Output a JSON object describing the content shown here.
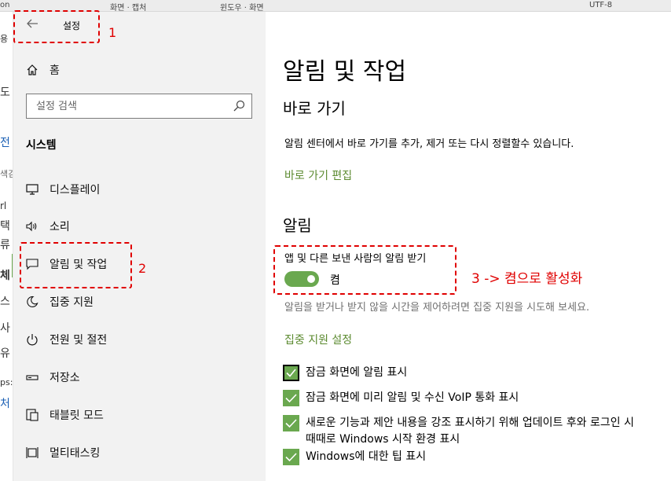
{
  "background_window": {
    "top_fragments": [
      "on",
      "화면 · 캡처",
      "윈도우 · 화면",
      "UTF-8"
    ],
    "left_fragments": [
      "용",
      "도",
      "전",
      "색검",
      "rl",
      "택",
      "류",
      "체",
      "스",
      "사",
      "유",
      "ps:",
      "처"
    ]
  },
  "window": {
    "title": "설정"
  },
  "sidebar": {
    "home_label": "홈",
    "search_placeholder": "설정 검색",
    "section_title": "시스템",
    "items": [
      {
        "label": "디스플레이",
        "icon": "monitor-icon"
      },
      {
        "label": "소리",
        "icon": "speaker-icon"
      },
      {
        "label": "알림 및 작업",
        "icon": "notification-icon"
      },
      {
        "label": "집중 지원",
        "icon": "moon-icon"
      },
      {
        "label": "전원 및 절전",
        "icon": "power-icon"
      },
      {
        "label": "저장소",
        "icon": "storage-icon"
      },
      {
        "label": "태블릿 모드",
        "icon": "tablet-icon"
      },
      {
        "label": "멀티태스킹",
        "icon": "multitask-icon"
      }
    ]
  },
  "main": {
    "page_title": "알림 및 작업",
    "shortcuts": {
      "heading": "바로 가기",
      "description": "알림 센터에서 바로 가기를 추가, 제거 또는 다시 정렬할수 있습니다.",
      "edit_link": "바로 가기 편집"
    },
    "notifications": {
      "heading": "알림",
      "toggle_label": "앱 및 다른 보낸 사람의 알림 받기",
      "toggle_state": "켬",
      "toggle_on": true,
      "hint": "알림을 받거나 받지 않을 시간을 제어하려면 집중 지원을 시도해 보세요.",
      "focus_link": "집중 지원 설정",
      "checkboxes": [
        {
          "label": "잠금 화면에 알림 표시",
          "checked": true
        },
        {
          "label": "잠금 화면에 미리 알림 및 수신 VoIP 통화 표시",
          "checked": true
        },
        {
          "label": "새로운 기능과 제안 내용을 강조 표시하기 위해 업데이트 후와 로그인 시 때때로 Windows 시작 환경 표시",
          "checked": true
        },
        {
          "label": "Windows에 대한 팁 표시",
          "checked": true
        }
      ]
    }
  },
  "annotations": {
    "one": "1",
    "two": "2",
    "three": "3 -> 켬으로 활성화"
  },
  "colors": {
    "accent": "#6aa84f",
    "link": "#5b8a2f",
    "annotation": "#e00000",
    "sidebar_bg": "#f2f2f2"
  }
}
